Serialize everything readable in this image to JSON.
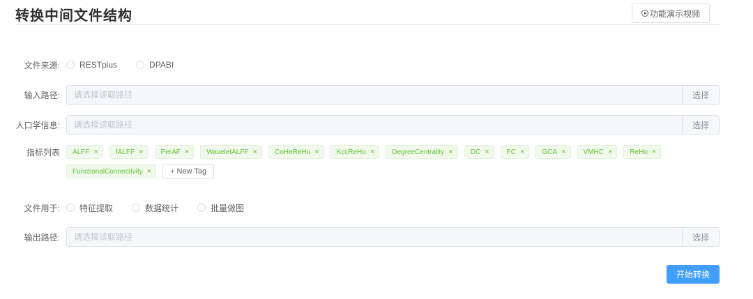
{
  "page": {
    "title": "转换中间文件结构",
    "demo_button": "功能演示视频"
  },
  "file_source": {
    "label": "文件来源:",
    "options": [
      "RESTplus",
      "DPABI"
    ]
  },
  "input_path": {
    "label": "输入路径:",
    "placeholder": "请选择读取路径",
    "button": "选择"
  },
  "demographics": {
    "label": "人口学信息:",
    "placeholder": "请选择读取路径",
    "button": "选择"
  },
  "metrics": {
    "label": "指标列表",
    "tags": [
      "ALFF",
      "fALFF",
      "PerAF",
      "WaveletALFF",
      "CoHeReHo",
      "KccReHo",
      "DegreeCentrality",
      "DC",
      "FC",
      "GCA",
      "VMHC",
      "ReHo",
      "FunctionalConnectivity"
    ],
    "close_glyph": "×",
    "new_tag": "+ New Tag"
  },
  "file_usage": {
    "label": "文件用于:",
    "options": [
      "特征提取",
      "数据统计",
      "批量做图"
    ]
  },
  "output_path": {
    "label": "输出路径:",
    "placeholder": "请选择读取路径",
    "button": "选择"
  },
  "actions": {
    "start": "开始转换"
  }
}
